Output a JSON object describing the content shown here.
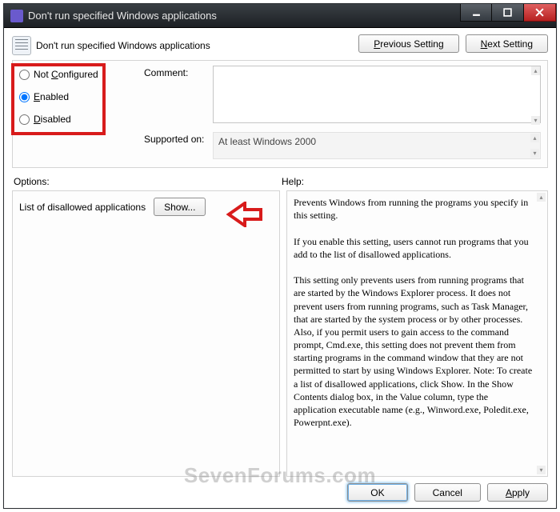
{
  "titlebar": {
    "text": "Don't run specified Windows applications"
  },
  "header": {
    "caption": "Don't run specified Windows applications",
    "prev": "Previous Setting",
    "next": "Next Setting"
  },
  "state": {
    "not_configured": "Not Configured",
    "enabled": "Enabled",
    "disabled": "Disabled",
    "selected": "enabled"
  },
  "comment": {
    "label": "Comment:",
    "value": ""
  },
  "supported": {
    "label": "Supported on:",
    "value": "At least Windows 2000"
  },
  "labels": {
    "options": "Options:",
    "help": "Help:"
  },
  "options": {
    "list_label": "List of disallowed applications",
    "show": "Show..."
  },
  "help": {
    "text": "Prevents Windows from running the programs you specify in this setting.\n\nIf you enable this setting, users cannot run programs that you add to the list of disallowed applications.\n\nThis setting only prevents users from running programs that are started by the Windows Explorer process. It does not prevent users from running programs, such as Task Manager, that are started by the system process or by other processes. Also, if you permit users to gain access to the command prompt, Cmd.exe, this setting does not prevent them from starting programs in the command window that they are not permitted to start by using Windows Explorer. Note: To create a list of disallowed applications, click Show. In the Show Contents dialog box, in the Value column, type the application executable name (e.g., Winword.exe, Poledit.exe, Powerpnt.exe)."
  },
  "buttons": {
    "ok": "OK",
    "cancel": "Cancel",
    "apply": "Apply"
  },
  "watermark": "SevenForums.com"
}
